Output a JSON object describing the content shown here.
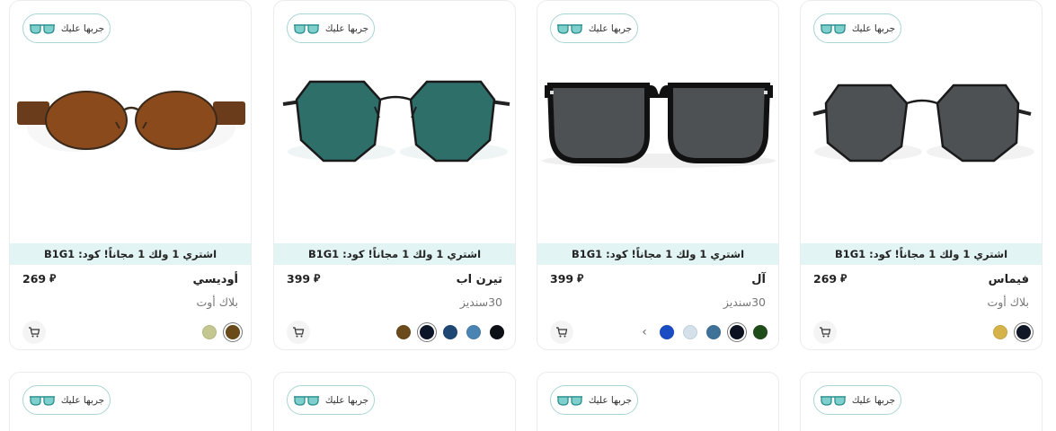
{
  "tryon_label": "جربها عليك",
  "promo_text": "اشتري 1 ولك 1 مجاناً! كود: B1G1",
  "currency_symbol": "⃁",
  "products": [
    {
      "name": "فيماس",
      "subtitle": "بلاك أوت",
      "price": "269",
      "swatches": [
        "#101828",
        "#d6b24a"
      ],
      "selected_swatch": 0
    },
    {
      "name": "آل",
      "subtitle": "30سنديز",
      "price": "399",
      "swatches": [
        "#1f4d1a",
        "#0c1220",
        "#3f7299",
        "#d4e1ea",
        "#1a4cc4"
      ],
      "selected_swatch": 1,
      "more_colors_icon": "chevron-left-icon"
    },
    {
      "name": "تيرن اب",
      "subtitle": "30سنديز",
      "price": "399",
      "swatches": [
        "#0d1117",
        "#4a84b3",
        "#1f4773",
        "#0d1528",
        "#6b4a1c"
      ],
      "selected_swatch": 3
    },
    {
      "name": "أوديسي",
      "subtitle": "بلاك أوت",
      "price": "269",
      "swatches": [
        "#6a4a18",
        "#c5c790"
      ],
      "selected_swatch": 0
    }
  ],
  "colors": {
    "promo_bg": "#e2f5f4",
    "tryon_border": "#a9d4d4",
    "lens_teal": "#2f6f6a",
    "lens_brown": "#8a4a1c",
    "lens_gray": "#4d5154"
  }
}
